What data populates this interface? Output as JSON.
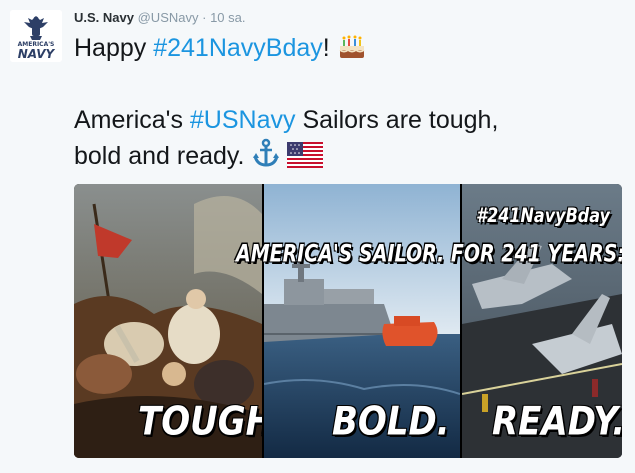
{
  "tweet": {
    "author_name": "U.S. Navy",
    "author_handle": "@USNavy",
    "separator": "·",
    "timestamp": "10 sa.",
    "avatar_text_top": "AMERICA'S",
    "avatar_text_bottom": "NAVY",
    "text_line1_plain": "Happy ",
    "text_line1_hashtag": "#241NavyBday",
    "text_line1_end": "!",
    "text_line2_plain": "America's ",
    "text_line2_hashtag": "#USNavy",
    "text_line2_end": " Sailors are tough,",
    "text_line3": "bold and ready.",
    "emojis": [
      "birthday-cake-icon",
      "anchor-icon",
      "us-flag-icon"
    ],
    "colors": {
      "hashtag": "#1b95e0",
      "text": "#14171a",
      "meta": "#8899a6",
      "background": "#f5f8fa"
    }
  },
  "media": {
    "hashtag_overlay": "#241NavyBday",
    "banner": "AMERICA'S SAILOR. FOR 241 YEARS:",
    "panel_words": [
      "TOUGH.",
      "BOLD.",
      "READY."
    ]
  }
}
